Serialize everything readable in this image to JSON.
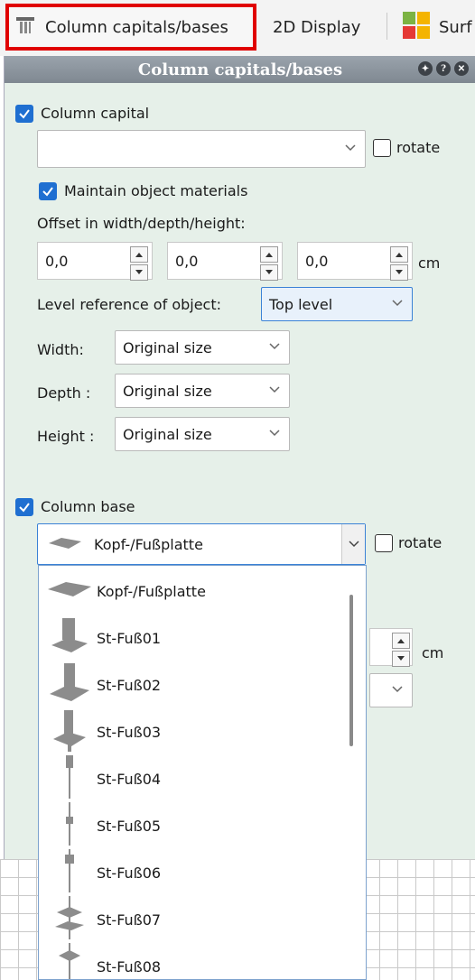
{
  "tabs": [
    {
      "label": "Column capitals/bases",
      "active": true,
      "icon": "column-icon"
    },
    {
      "label": "2D Display",
      "active": false
    },
    {
      "label": "Surf",
      "active": false,
      "icon": "surface-icon"
    }
  ],
  "panel": {
    "title": "Column capitals/bases",
    "title_buttons": [
      "pin",
      "help",
      "close"
    ]
  },
  "capital": {
    "checkbox_label": "Column capital",
    "checked": true,
    "combo_value": "",
    "rotate_label": "rotate",
    "rotate_checked": false,
    "maintain_label": "Maintain object materials",
    "maintain_checked": true,
    "offset_label": "Offset in width/depth/height:",
    "offset_values": [
      "0,0",
      "0,0",
      "0,0"
    ],
    "offset_unit": "cm",
    "level_label": "Level reference of object:",
    "level_value": "Top level",
    "width_label": "Width:",
    "width_value": "Original size",
    "depth_label": "Depth :",
    "depth_value": "Original size",
    "height_label": "Height :",
    "height_value": "Original size"
  },
  "base": {
    "checkbox_label": "Column base",
    "checked": true,
    "combo_value": "Kopf-/Fußplatte",
    "rotate_label": "rotate",
    "rotate_checked": false,
    "hidden_unit": "cm"
  },
  "dropdown": {
    "items": [
      "Kopf-/Fußplatte",
      "St-Fuß01",
      "St-Fuß02",
      "St-Fuß03",
      "St-Fuß04",
      "St-Fuß05",
      "St-Fuß06",
      "St-Fuß07",
      "St-Fuß08"
    ]
  },
  "colors": {
    "accent": "#1f6fd1",
    "panel_bg": "#e6f0e9",
    "highlight": "#e00000"
  }
}
